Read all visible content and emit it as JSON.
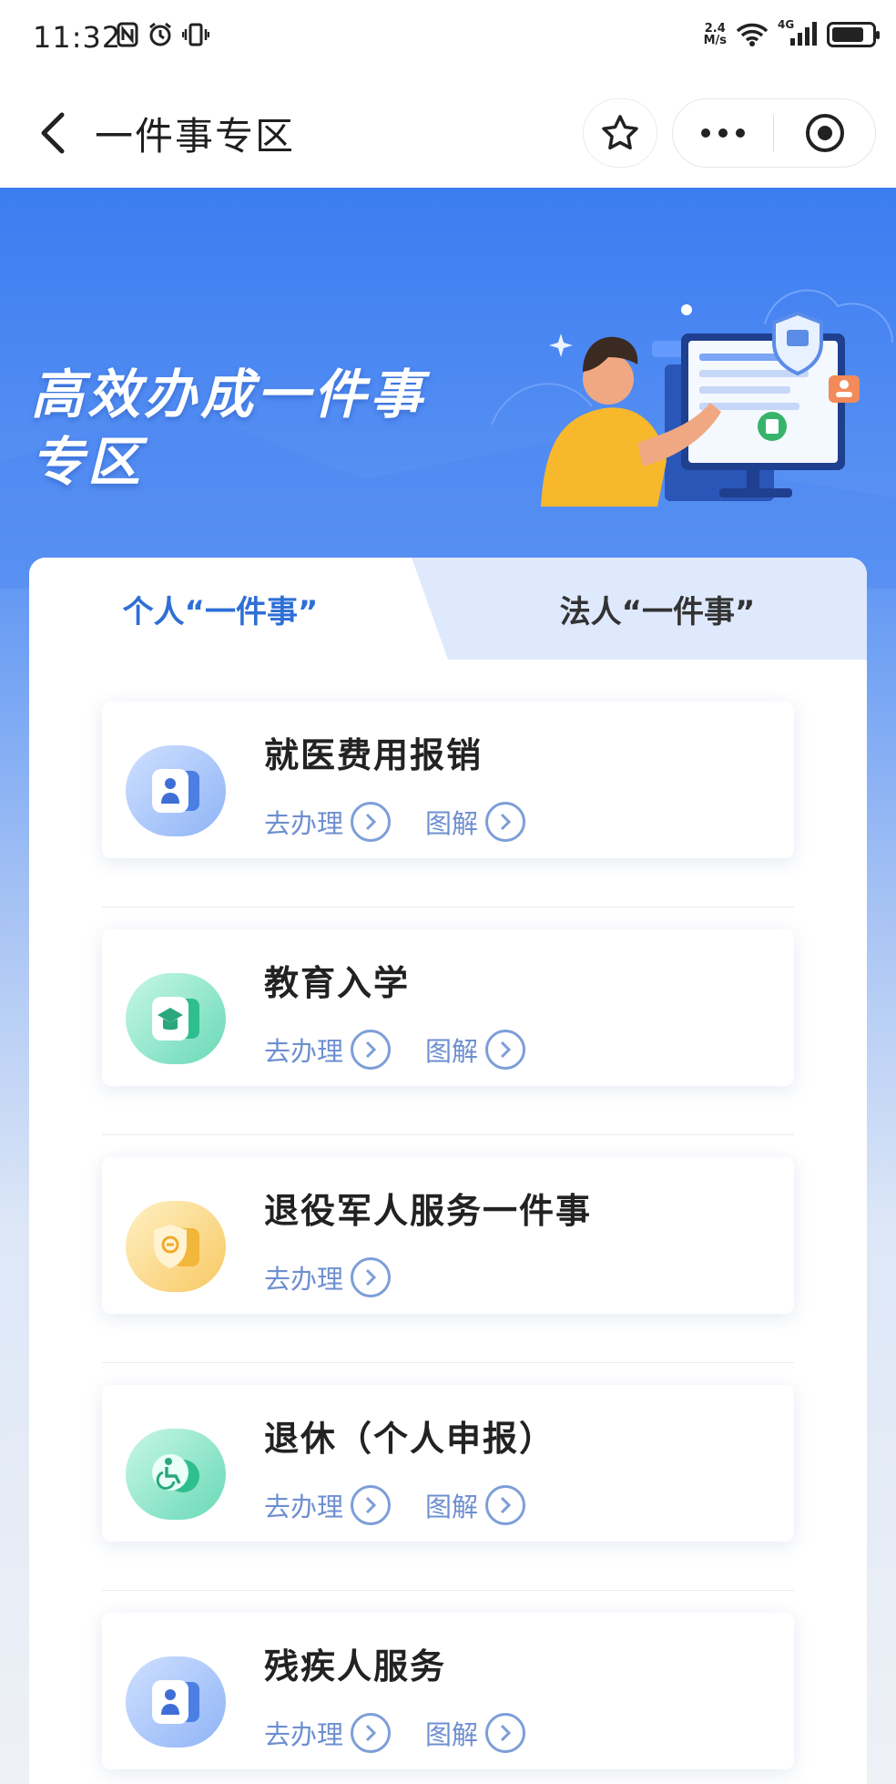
{
  "status_bar": {
    "time": "11:32",
    "speed_top": "2.4",
    "speed_unit": "M/s",
    "network": "4G",
    "icons": [
      "nfc-icon",
      "alarm-icon",
      "vibrate-icon",
      "wifi-icon",
      "signal-icon",
      "battery-icon"
    ]
  },
  "nav": {
    "title": "一件事专区",
    "icons": [
      "back-arrow-icon",
      "star-icon",
      "more-dots-icon",
      "target-circle-icon"
    ]
  },
  "banner": {
    "line1": "高效办成一件事",
    "line2": "专区"
  },
  "tabs": {
    "personal": "个人“一件事”",
    "legal": "法人“一件事”",
    "active": "personal"
  },
  "items": [
    {
      "title": "就医费用报销",
      "action_go": "去办理",
      "action_guide": "图解",
      "icon": "medical-person-icon",
      "color": "blue"
    },
    {
      "title": "教育入学",
      "action_go": "去办理",
      "action_guide": "图解",
      "icon": "graduation-cap-icon",
      "color": "green"
    },
    {
      "title": "退役军人服务一件事",
      "action_go": "去办理",
      "action_guide": "",
      "icon": "veteran-shield-icon",
      "color": "yellow"
    },
    {
      "title": "退休（个人申报）",
      "action_go": "去办理",
      "action_guide": "图解",
      "icon": "wheelchair-icon",
      "color": "green"
    },
    {
      "title": "残疾人服务",
      "action_go": "去办理",
      "action_guide": "图解",
      "icon": "disability-person-icon",
      "color": "blue"
    }
  ],
  "colors": {
    "accent": "#2f6fd6",
    "banner": "#3b7cf1",
    "action_text": "#6e8fd0"
  }
}
